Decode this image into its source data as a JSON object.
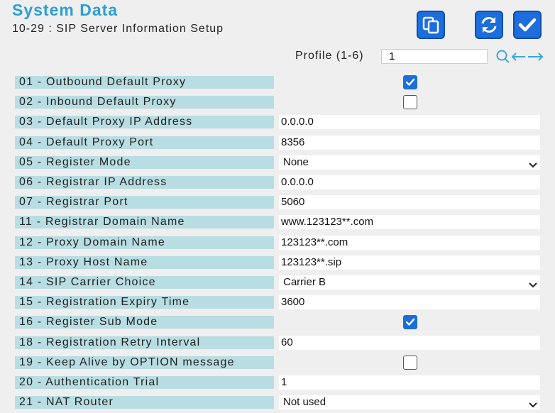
{
  "header": {
    "title": "System Data",
    "subtitle": "10-29 : SIP Server Information Setup"
  },
  "toolbar": {
    "copy_icon": "copy-icon",
    "refresh_icon": "refresh-icon",
    "apply_icon": "check-icon"
  },
  "profile": {
    "label": "Profile (1-6)",
    "value": "1"
  },
  "rows": [
    {
      "label": "01 - Outbound Default Proxy",
      "type": "checkbox",
      "checked": true
    },
    {
      "label": "02 - Inbound Default Proxy",
      "type": "checkbox",
      "checked": false
    },
    {
      "label": "03 - Default Proxy IP Address",
      "type": "text",
      "value": "0.0.0.0"
    },
    {
      "label": "04 - Default Proxy Port",
      "type": "text",
      "value": "8356"
    },
    {
      "label": "05 - Register Mode",
      "type": "select",
      "value": "None"
    },
    {
      "label": "06 - Registrar IP Address",
      "type": "text",
      "value": "0.0.0.0"
    },
    {
      "label": "07 - Registrar Port",
      "type": "text",
      "value": "5060"
    },
    {
      "label": "11 - Registrar Domain Name",
      "type": "text",
      "value": "www.123123**.com"
    },
    {
      "label": "12 - Proxy Domain Name",
      "type": "text",
      "value": "123123**.com"
    },
    {
      "label": "13 - Proxy Host Name",
      "type": "text",
      "value": "123123**.sip"
    },
    {
      "label": "14 - SIP Carrier Choice",
      "type": "select",
      "value": "Carrier B"
    },
    {
      "label": "15 - Registration Expiry Time",
      "type": "text",
      "value": "3600"
    },
    {
      "label": "16 - Register Sub Mode",
      "type": "checkbox",
      "checked": true
    },
    {
      "label": "18 - Registration Retry Interval",
      "type": "text",
      "value": "60"
    },
    {
      "label": "19 - Keep Alive by OPTION message",
      "type": "checkbox",
      "checked": false
    },
    {
      "label": "20 - Authentication Trial",
      "type": "text",
      "value": "1"
    },
    {
      "label": "21 - NAT Router",
      "type": "select",
      "value": "Not used"
    }
  ],
  "colors": {
    "title": "#2a9fd8",
    "label_bg": "#b8dde2",
    "button": "#1e6ddc"
  }
}
